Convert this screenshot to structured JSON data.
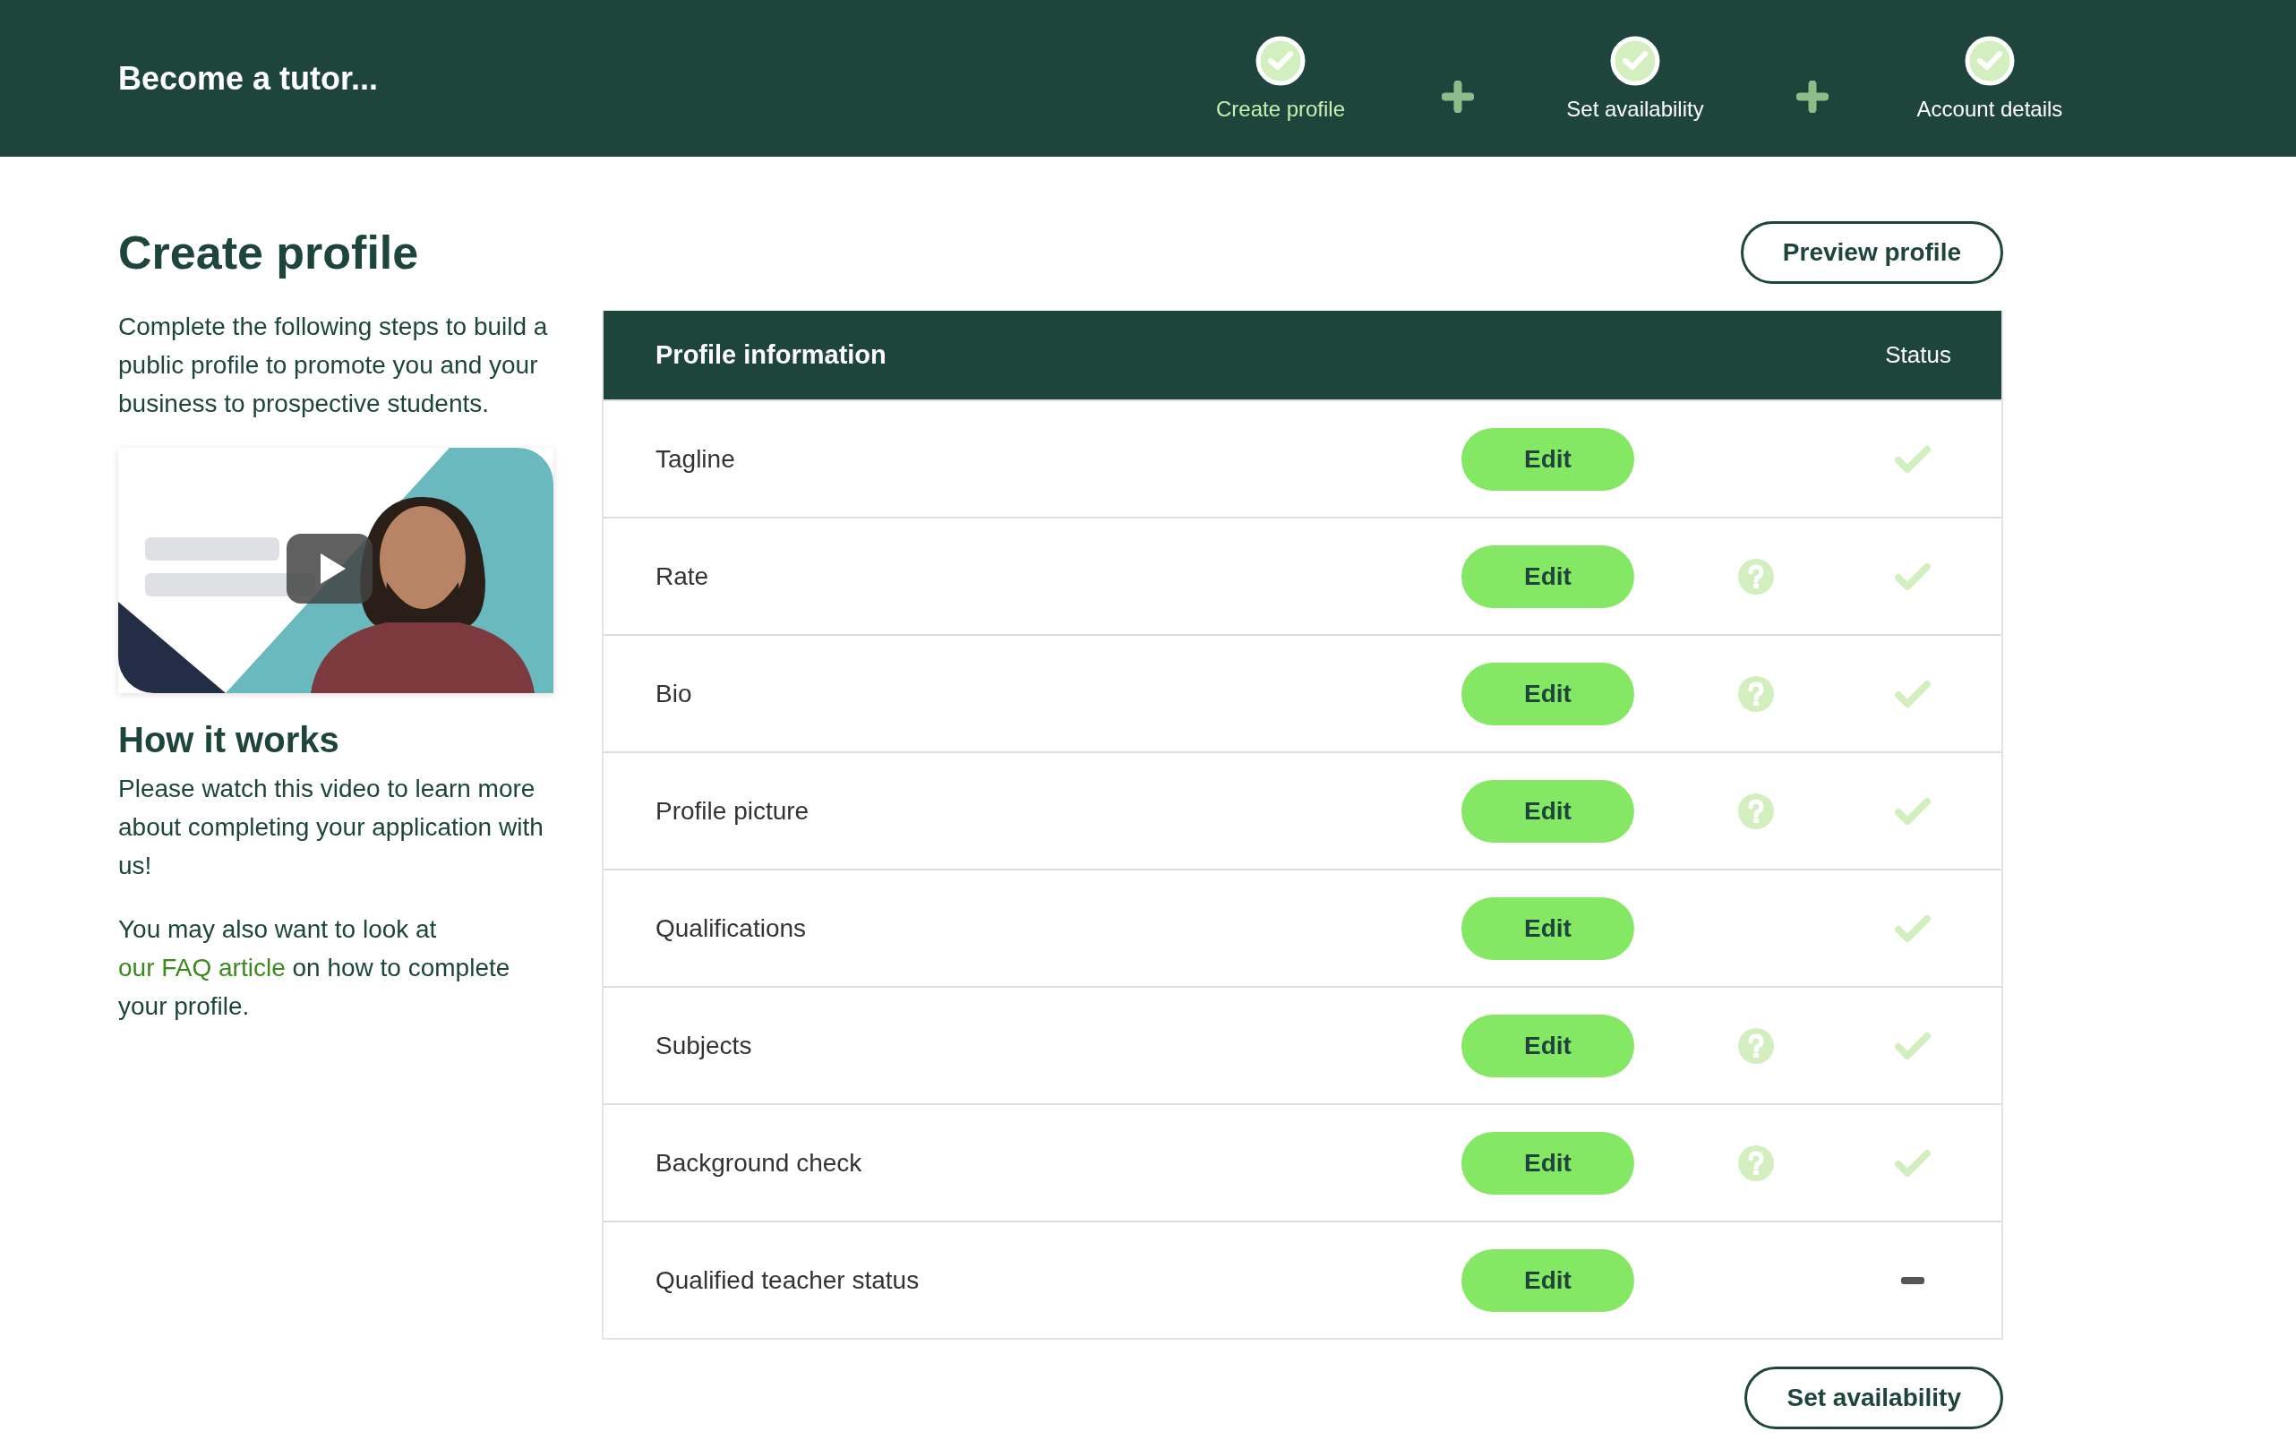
{
  "header": {
    "title": "Become a tutor...",
    "steps": [
      {
        "label": "Create profile",
        "completed": true,
        "selected": true
      },
      {
        "label": "Set availability",
        "completed": true,
        "selected": false
      },
      {
        "label": "Account details",
        "completed": true,
        "selected": false
      }
    ]
  },
  "sidebar": {
    "heading": "Create profile",
    "description": "Complete the following steps to build a public profile to promote you and your business to prospective students.",
    "how_heading": "How it works",
    "how_text": "Please watch this video to learn more about completing your application with us!",
    "faq": {
      "before": "You may also want to look at",
      "link": "our FAQ article",
      "after": "on how to complete your profile."
    }
  },
  "preview_button": "Preview profile",
  "table": {
    "columns": [
      "Profile information",
      "Status"
    ],
    "rows": [
      {
        "label": "Tagline",
        "button": "Edit",
        "help": false,
        "complete": true
      },
      {
        "label": "Rate",
        "button": "Edit",
        "help": true,
        "complete": true
      },
      {
        "label": "Bio",
        "button": "Edit",
        "help": true,
        "complete": true
      },
      {
        "label": "Profile picture",
        "button": "Edit",
        "help": true,
        "complete": true
      },
      {
        "label": "Qualifications",
        "button": "Edit",
        "help": false,
        "complete": true
      },
      {
        "label": "Subjects",
        "button": "Edit",
        "help": true,
        "complete": true
      },
      {
        "label": "Background check",
        "button": "Edit",
        "help": true,
        "complete": true
      },
      {
        "label": "Qualified teacher status",
        "button": "Edit",
        "help": false,
        "complete": false
      }
    ]
  },
  "next_button": "Set availability"
}
